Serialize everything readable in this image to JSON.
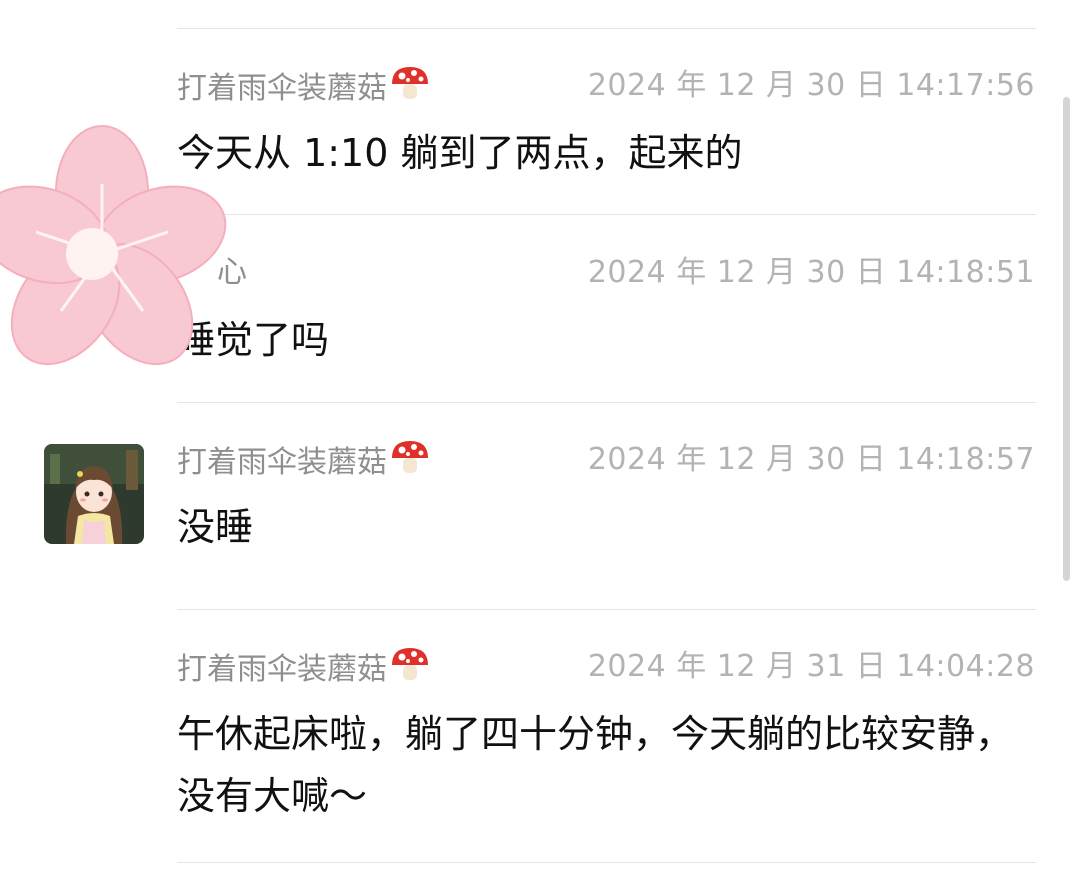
{
  "messages": [
    {
      "sender": "打着雨伞装蘑菇",
      "sender_emoji": "mushroom-icon",
      "time": "2024 年 12 月 30 日 14:17:56",
      "text": "今天从 1:10 躺到了两点，起来的"
    },
    {
      "sender": "心",
      "time": "2024 年 12 月 30 日 14:18:51",
      "text": "睡觉了吗"
    },
    {
      "sender": "打着雨伞装蘑菇",
      "sender_emoji": "mushroom-icon",
      "time": "2024 年 12 月 30 日 14:18:57",
      "text": "没睡"
    },
    {
      "sender": "打着雨伞装蘑菇",
      "sender_emoji": "mushroom-icon",
      "time": "2024 年 12 月 31 日 14:04:28",
      "text": "午休起床啦，躺了四十分钟，今天躺的比较安静，没有大喊～"
    }
  ],
  "colors": {
    "sender": "#8f8f8f",
    "time": "#b3b3b3",
    "text": "#111111",
    "divider": "#e6e6e6",
    "flower_sticker": "#f9c9d3"
  }
}
